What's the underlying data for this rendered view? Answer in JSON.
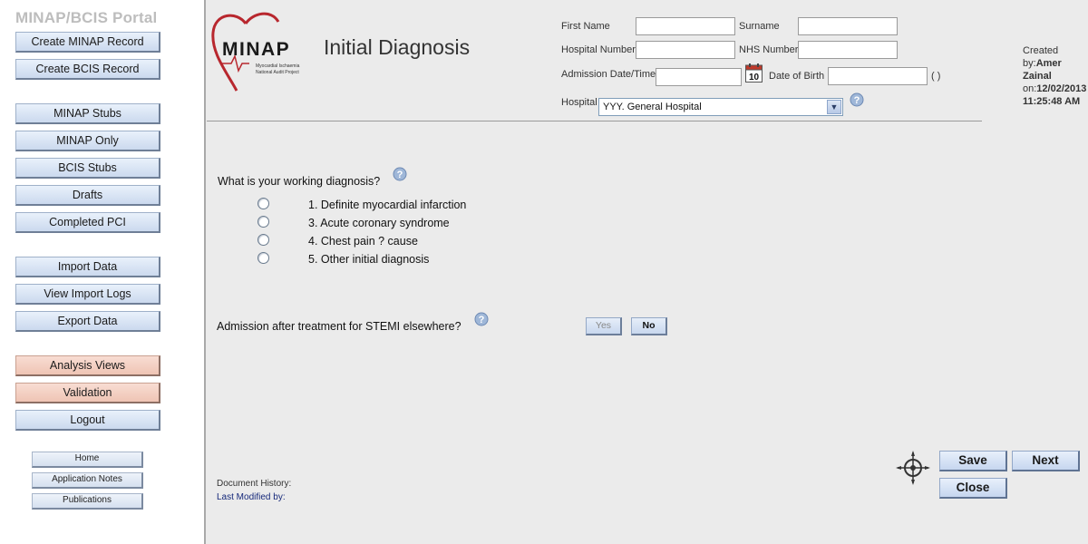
{
  "sidebar": {
    "title": "MINAP/BCIS Portal",
    "buttons": [
      "Create MINAP Record",
      "Create BCIS Record",
      "MINAP Stubs",
      "MINAP Only",
      "BCIS Stubs",
      "Drafts",
      "Completed PCI",
      "Import Data",
      "View Import Logs",
      "Export Data",
      "Analysis Views",
      "Validation",
      "Logout"
    ],
    "links": [
      "Home",
      "Application Notes",
      "Publications"
    ]
  },
  "header": {
    "logo_text": "MINAP",
    "logo_sub1": "Myocardial Ischaemia",
    "logo_sub2": "National Audit Project",
    "title": "Initial Diagnosis",
    "fields": {
      "first_name": "First Name",
      "surname": "Surname",
      "hospital_number": "Hospital Number",
      "nhs_number": "NHS Number",
      "admission": "Admission Date/Time",
      "dob": "Date of Birth",
      "dob_suffix": "( )",
      "hospital": "Hospital"
    },
    "hospital_value": "YYY. General Hospital",
    "calendar_day": "10"
  },
  "created": {
    "label": "Created by:",
    "user_first": "Amer",
    "user_last": "Zainal",
    "on_label": "on:",
    "date": "12/02/2013",
    "time": "11:25:48 AM"
  },
  "diagnosis": {
    "question": "What is your working diagnosis?",
    "options": [
      "1. Definite myocardial infarction",
      "3. Acute coronary syndrome",
      "4. Chest pain ? cause",
      "5. Other initial diagnosis"
    ]
  },
  "stemi": {
    "question": "Admission after treatment for STEMI elsewhere?",
    "yes": "Yes",
    "no": "No"
  },
  "footer": {
    "doc_history": "Document History:",
    "last_modified": "Last Modified by:"
  },
  "actions": {
    "save": "Save",
    "next": "Next",
    "close": "Close"
  },
  "colors": {
    "sidebar_button": "#cbd9ee",
    "pink_button": "#efc4b4",
    "logo_red": "#b8272e"
  }
}
